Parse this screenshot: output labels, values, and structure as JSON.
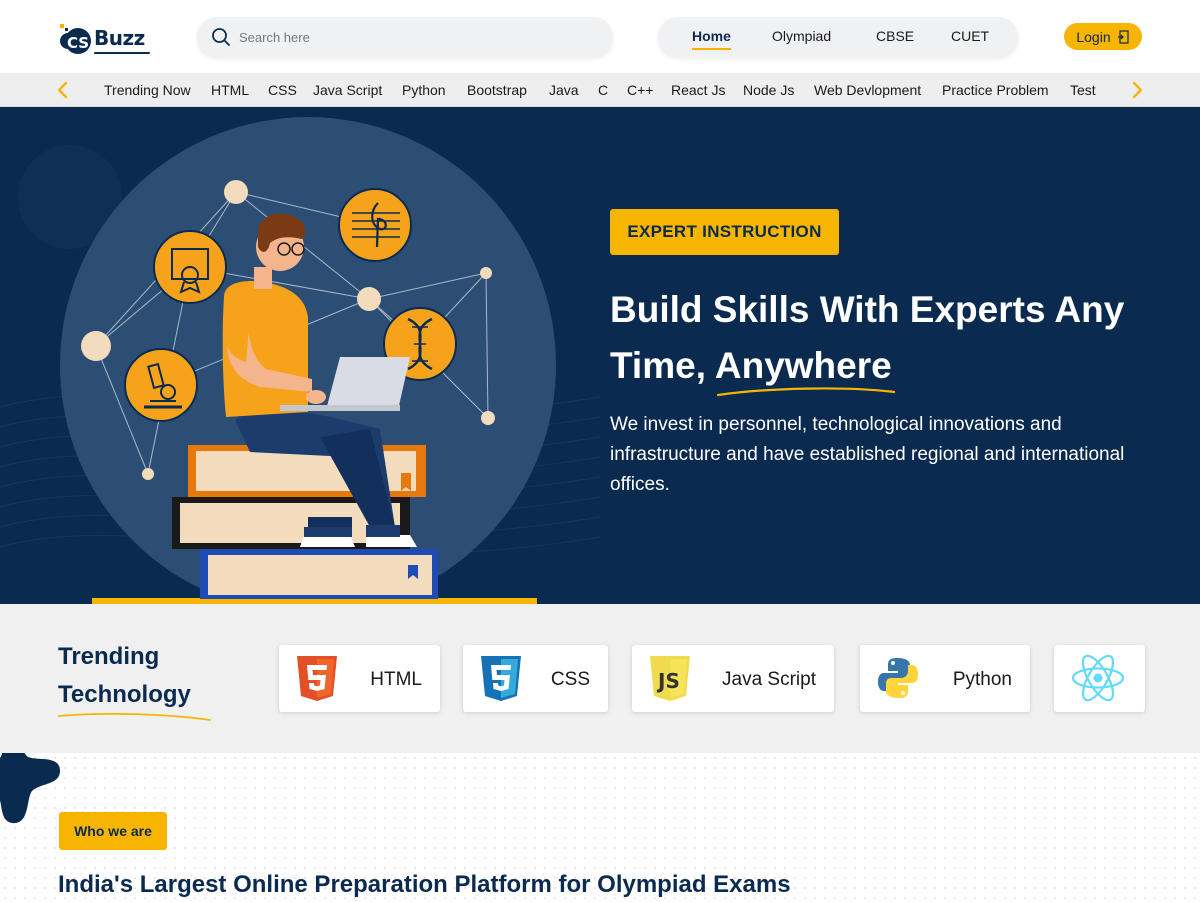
{
  "brand": {
    "logo_text": "Buzz",
    "logo_mark": "CS"
  },
  "search": {
    "placeholder": "Search here"
  },
  "top_nav": {
    "items": [
      {
        "label": "Home",
        "active": true
      },
      {
        "label": "Olympiad",
        "active": false
      },
      {
        "label": "CBSE",
        "active": false
      },
      {
        "label": "CUET",
        "active": false
      }
    ],
    "login_label": "Login"
  },
  "categories": [
    "Trending Now",
    "HTML",
    "CSS",
    "Java Script",
    "Python",
    "Bootstrap",
    "Java",
    "C",
    "C++",
    "React Js",
    "Node Js",
    "Web Devlopment",
    "Practice Problem",
    "Test"
  ],
  "hero": {
    "badge": "EXPERT INSTRUCTION",
    "title_line1": "Build Skills With Experts Any",
    "title_line2": "Time, Anywhere",
    "description": "We invest in personnel, technological innovations and infrastructure and have established regional and international offices."
  },
  "trending": {
    "title_line1": "Trending",
    "title_line2": "Technology",
    "cards": [
      {
        "label": "HTML",
        "icon": "html5-icon"
      },
      {
        "label": "CSS",
        "icon": "css3-icon"
      },
      {
        "label": "Java Script",
        "icon": "javascript-icon"
      },
      {
        "label": "Python",
        "icon": "python-icon"
      },
      {
        "label": "",
        "icon": "react-icon"
      }
    ]
  },
  "who": {
    "badge": "Who we are",
    "heading": "India's Largest Online Preparation Platform for Olympiad Exams"
  },
  "colors": {
    "navy": "#0b2a4f",
    "accent": "#f7b500",
    "strip": "#eeeeee"
  }
}
